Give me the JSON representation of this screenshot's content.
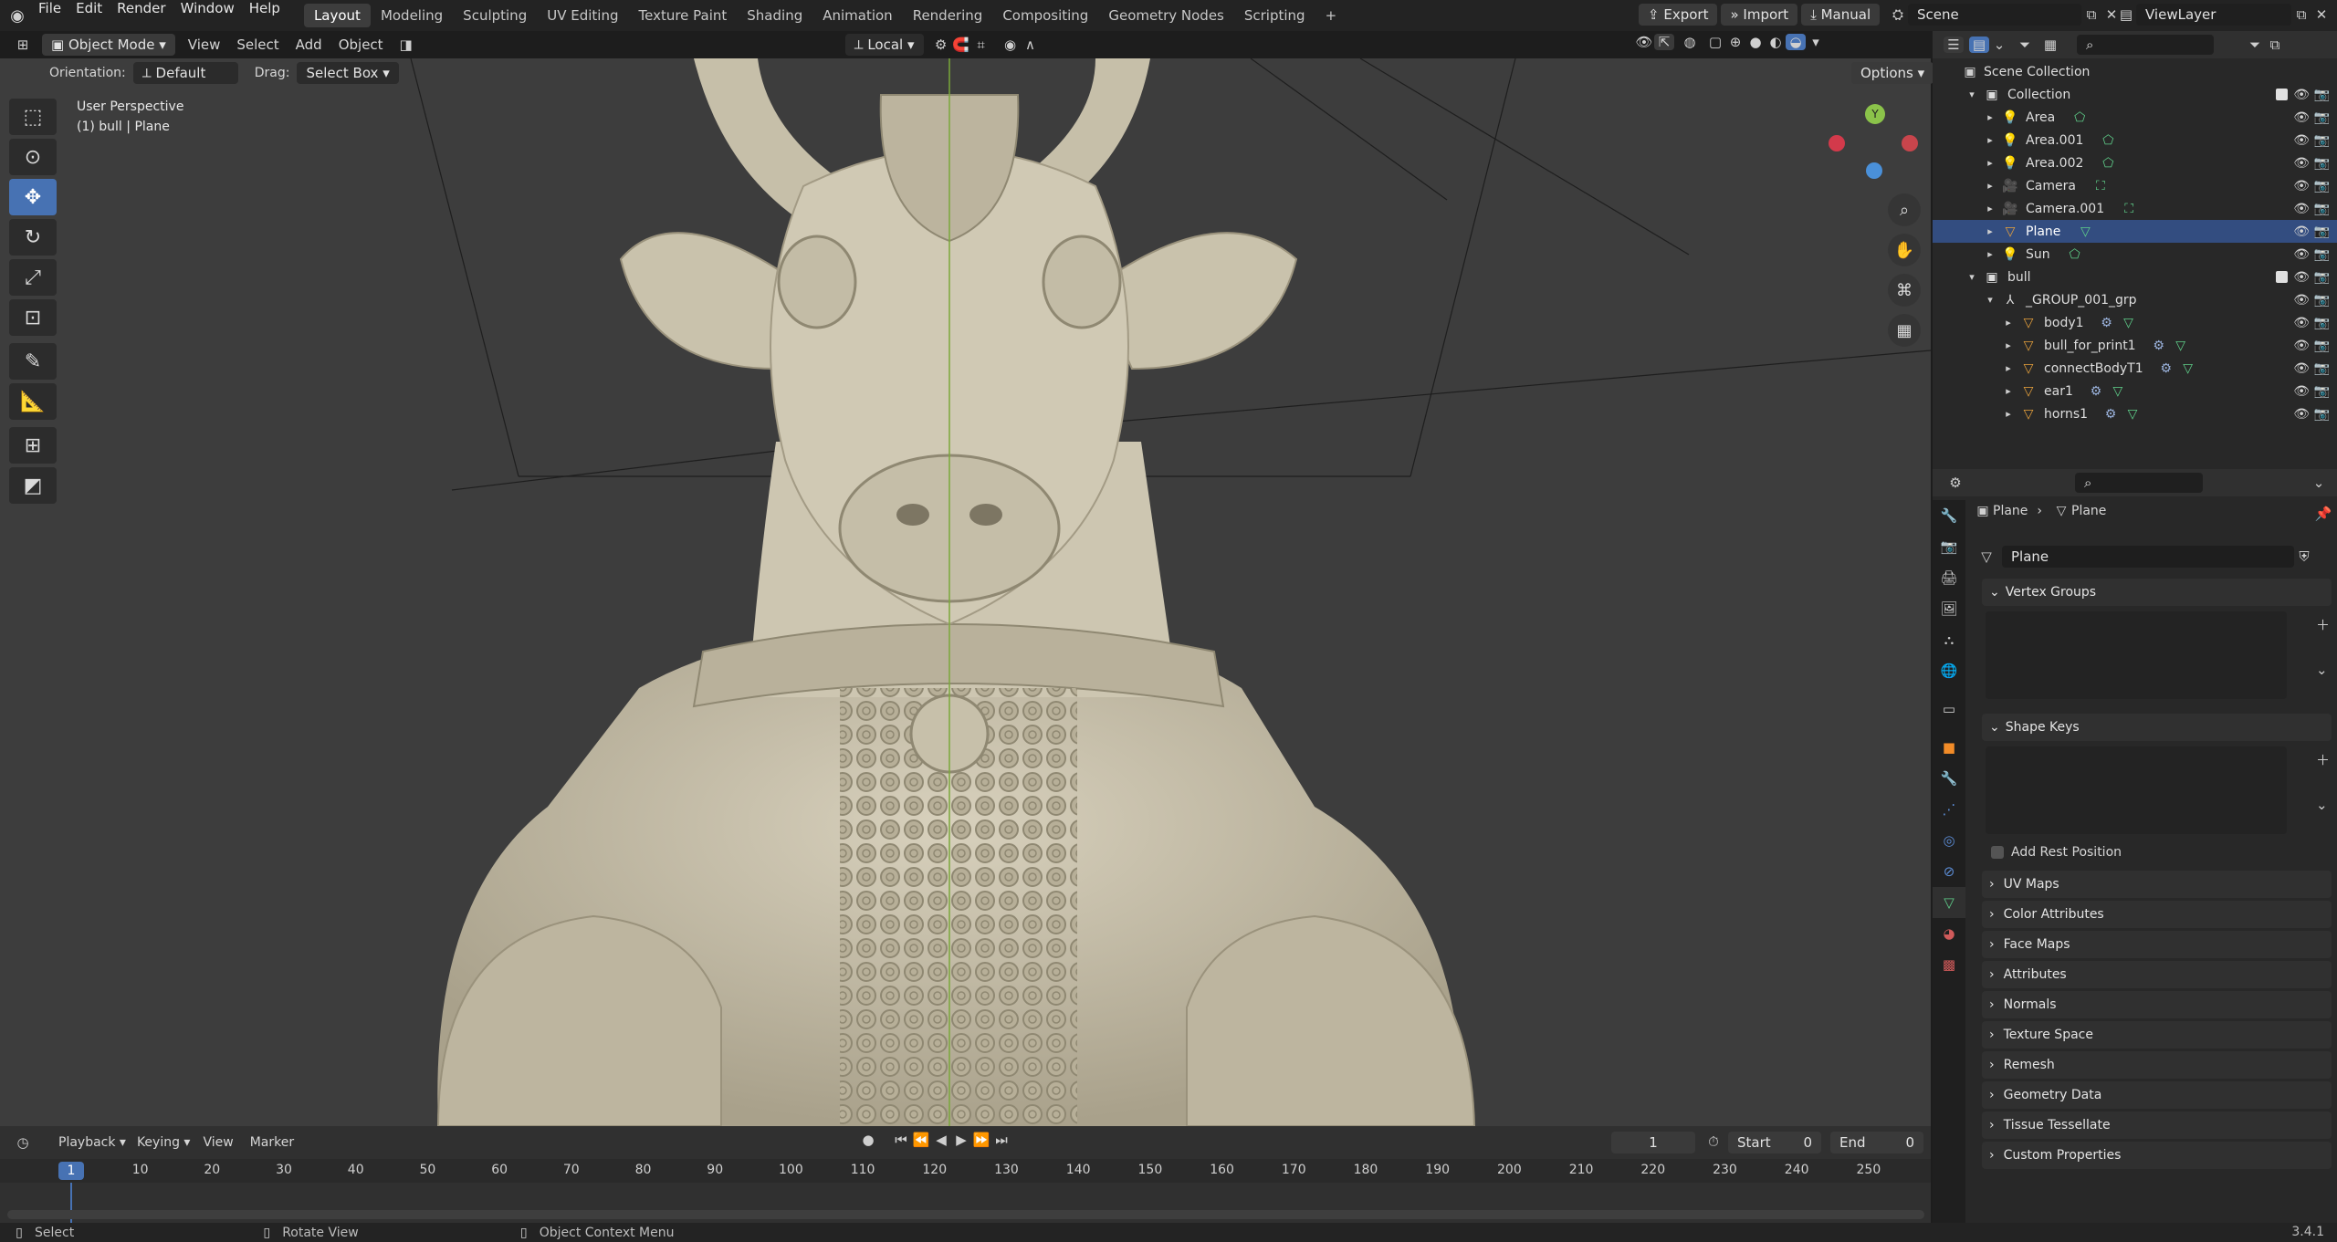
{
  "topbar": {
    "menus": [
      "File",
      "Edit",
      "Render",
      "Window",
      "Help"
    ],
    "workspaces": [
      "Layout",
      "Modeling",
      "Sculpting",
      "UV Editing",
      "Texture Paint",
      "Shading",
      "Animation",
      "Rendering",
      "Compositing",
      "Geometry Nodes",
      "Scripting"
    ],
    "add_tab": "+",
    "export": "Export",
    "import": "Import",
    "manual": "Manual",
    "scene": "Scene",
    "viewlayer": "ViewLayer"
  },
  "vp_header": {
    "mode": "Object Mode",
    "menus": [
      "View",
      "Select",
      "Add",
      "Object"
    ],
    "transform": "Local",
    "orientation_label": "Orientation:",
    "orientation": "Default",
    "drag_label": "Drag:",
    "drag": "Select Box",
    "options": "Options"
  },
  "viewport": {
    "perspective": "User Perspective",
    "object_info": "(1) bull | Plane",
    "gizmo_y": "Y",
    "colors": {
      "bg": "#3d3d3d",
      "model": "#c9c2ad",
      "x_axis": "#d33a4b",
      "y_axis": "#8bc34a",
      "z_axis": "#4a90d9"
    }
  },
  "timeline": {
    "menus": [
      "Playback",
      "Keying",
      "View",
      "Marker"
    ],
    "current_frame": "1",
    "start_label": "Start",
    "start": "0",
    "end_label": "End",
    "end": "0",
    "ticks": [
      "10",
      "20",
      "30",
      "40",
      "50",
      "60",
      "70",
      "80",
      "90",
      "100",
      "110",
      "120",
      "130",
      "140",
      "150",
      "160",
      "170",
      "180",
      "190",
      "200",
      "210",
      "220",
      "230",
      "240",
      "250"
    ],
    "playhead": "1"
  },
  "status": {
    "select": "Select",
    "rotate": "Rotate View",
    "context": "Object Context Menu",
    "version": "3.4.1"
  },
  "outliner": {
    "root": "Scene Collection",
    "items": [
      {
        "label": "Collection",
        "indent": 1,
        "kind": "collection"
      },
      {
        "label": "Area",
        "indent": 2,
        "kind": "light"
      },
      {
        "label": "Area.001",
        "indent": 2,
        "kind": "light"
      },
      {
        "label": "Area.002",
        "indent": 2,
        "kind": "light"
      },
      {
        "label": "Camera",
        "indent": 2,
        "kind": "camera"
      },
      {
        "label": "Camera.001",
        "indent": 2,
        "kind": "camera"
      },
      {
        "label": "Plane",
        "indent": 2,
        "kind": "mesh",
        "selected": true
      },
      {
        "label": "Sun",
        "indent": 2,
        "kind": "light"
      },
      {
        "label": "bull",
        "indent": 1,
        "kind": "collection"
      },
      {
        "label": "_GROUP_001_grp",
        "indent": 2,
        "kind": "empty"
      },
      {
        "label": "body1",
        "indent": 3,
        "kind": "mesh"
      },
      {
        "label": "bull_for_print1",
        "indent": 3,
        "kind": "mesh"
      },
      {
        "label": "connectBodyT1",
        "indent": 3,
        "kind": "mesh"
      },
      {
        "label": "ear1",
        "indent": 3,
        "kind": "mesh"
      },
      {
        "label": "horns1",
        "indent": 3,
        "kind": "mesh"
      }
    ]
  },
  "properties": {
    "breadcrumb_obj": "Plane",
    "breadcrumb_data": "Plane",
    "datablock": "Plane",
    "vertex_groups": "Vertex Groups",
    "shape_keys": "Shape Keys",
    "add_rest": "Add Rest Position",
    "panels": [
      "UV Maps",
      "Color Attributes",
      "Face Maps",
      "Attributes",
      "Normals",
      "Texture Space",
      "Remesh",
      "Geometry Data",
      "Tissue Tessellate",
      "Custom Properties"
    ]
  }
}
